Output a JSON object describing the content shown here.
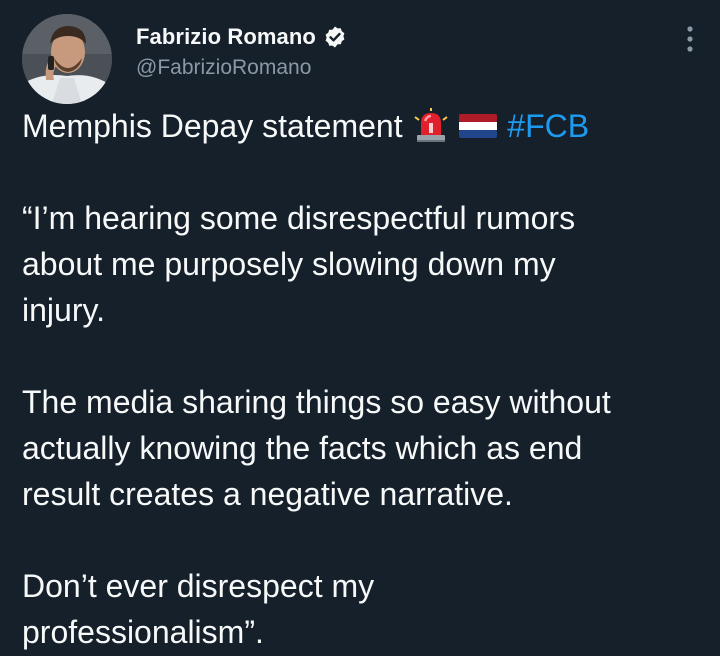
{
  "author": {
    "display_name": "Fabrizio Romano",
    "handle": "@FabrizioRomano",
    "verified_icon": "verified-badge-icon",
    "avatar": "avatar-photo"
  },
  "menu": {
    "icon": "more-options-icon"
  },
  "tweet": {
    "headline_text": "Memphis Depay statement ",
    "headline_emojis": [
      "rotating-light-icon",
      "netherlands-flag-icon"
    ],
    "hashtag": "#FCB",
    "lines_p1": [
      "“I’m hearing some disrespectful rumors",
      "about me purposely slowing down my",
      "injury."
    ],
    "lines_p2": [
      "The media sharing things so easy without",
      "actually knowing the facts which as end",
      "result creates a negative narrative."
    ],
    "lines_p3": [
      "Don’t ever disrespect my",
      "professionalism”."
    ]
  },
  "colors": {
    "background": "#15202b",
    "text": "#f7f9f9",
    "secondary_text": "#8b98a5",
    "link": "#1d9bf0"
  }
}
